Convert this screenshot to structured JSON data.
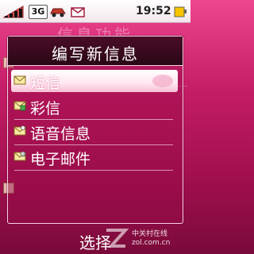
{
  "status_bar": {
    "network": "3G",
    "time": "19:52"
  },
  "background": {
    "title": "信息功能"
  },
  "popup": {
    "title": "编写新信息",
    "items": [
      {
        "label": "短信",
        "icon": "sms-envelope-icon",
        "selected": true
      },
      {
        "label": "彩信",
        "icon": "mms-envelope-icon",
        "selected": false
      },
      {
        "label": "语音信息",
        "icon": "voice-message-icon",
        "selected": false
      },
      {
        "label": "电子邮件",
        "icon": "email-icon",
        "selected": false
      }
    ]
  },
  "softkey": {
    "center_label": "选择"
  },
  "watermark": {
    "line1": "中关村在线",
    "line2": "zol.com.cn"
  },
  "colors": {
    "accent": "#c51d67",
    "header": "#2a0716",
    "selected": "#ffe6f0"
  }
}
